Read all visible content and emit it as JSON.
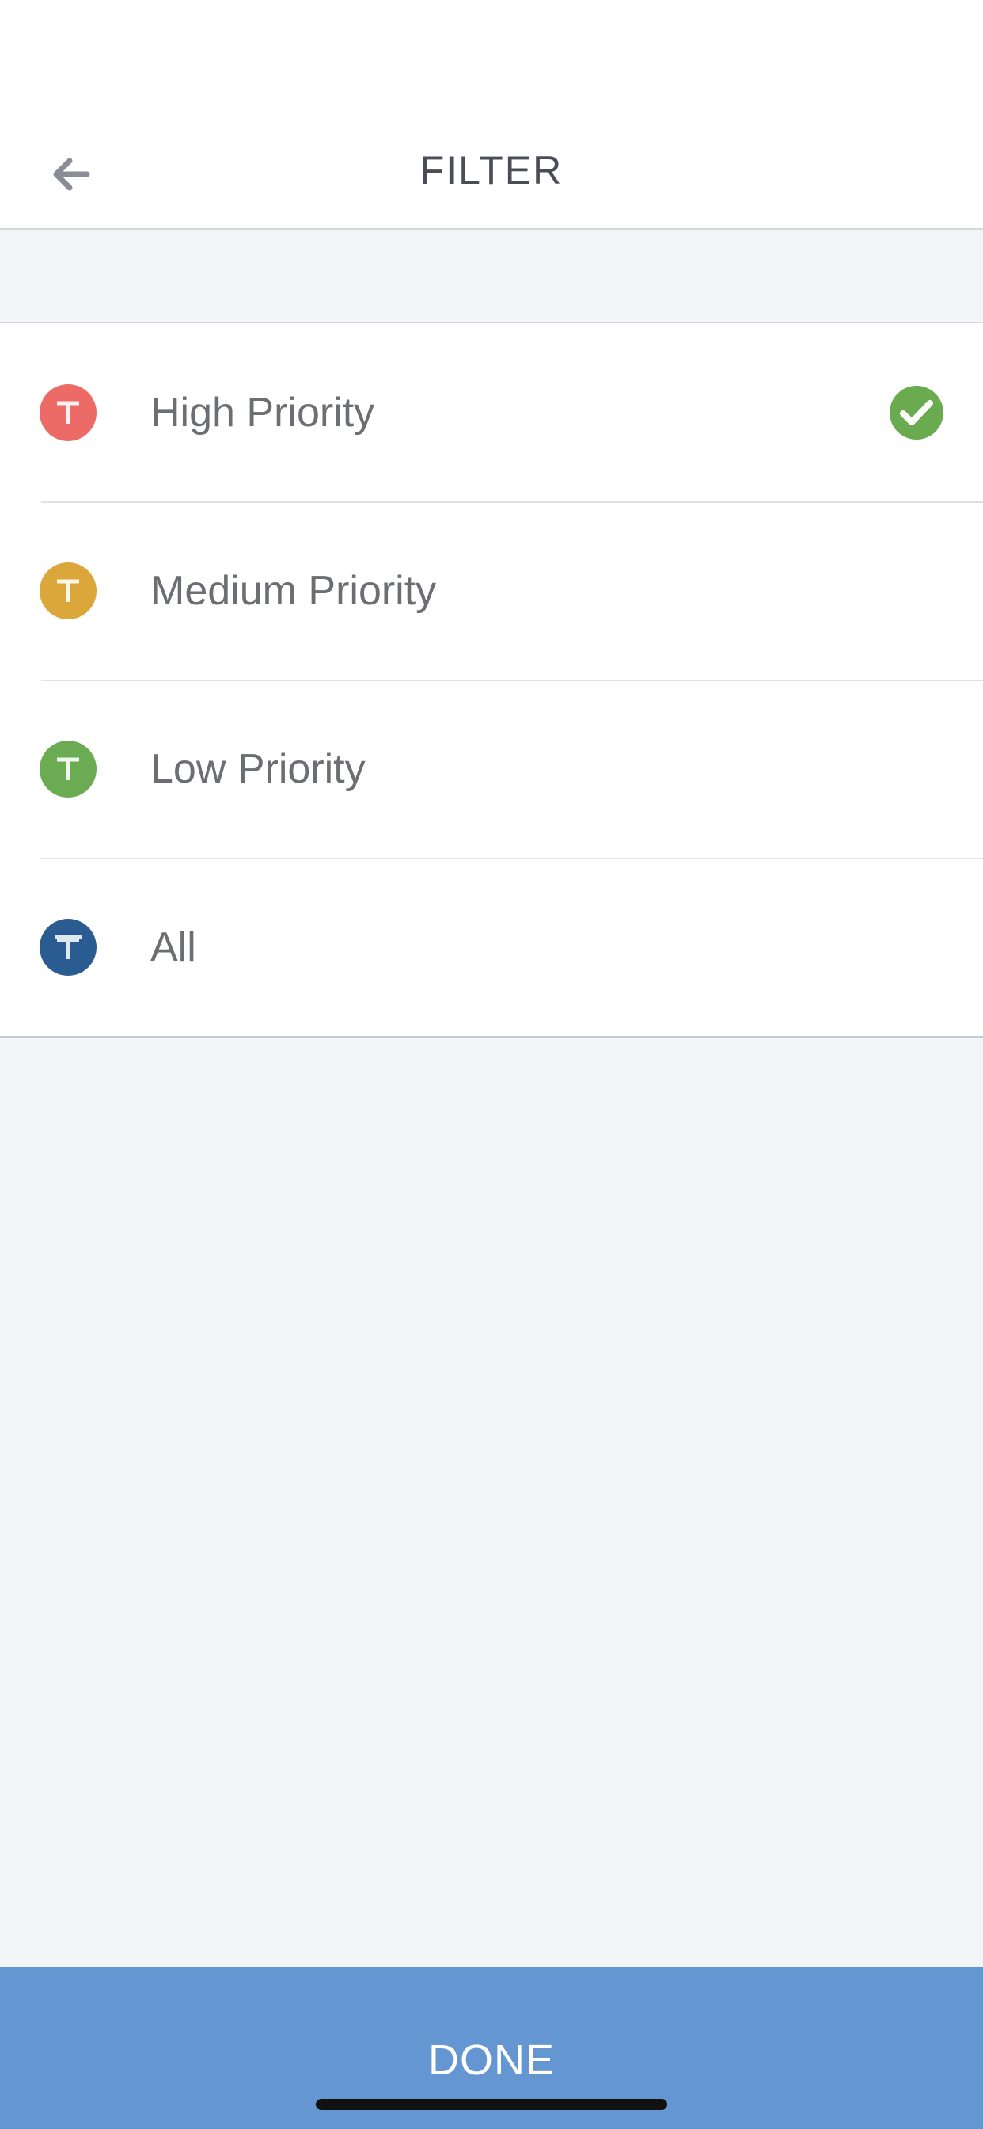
{
  "header": {
    "title": "FILTER",
    "back_icon": "arrow-left-icon"
  },
  "filters": [
    {
      "label": "High Priority",
      "badge_color": "#ec6b66",
      "selected": true
    },
    {
      "label": "Medium Priority",
      "badge_color": "#dba73b",
      "selected": false
    },
    {
      "label": "Low Priority",
      "badge_color": "#6bab52",
      "selected": false
    },
    {
      "label": "All",
      "badge_color": "#2a5c92",
      "selected": false
    }
  ],
  "checkmark_color": "#6aab4f",
  "footer": {
    "done_label": "DONE",
    "color": "#6497d2"
  }
}
